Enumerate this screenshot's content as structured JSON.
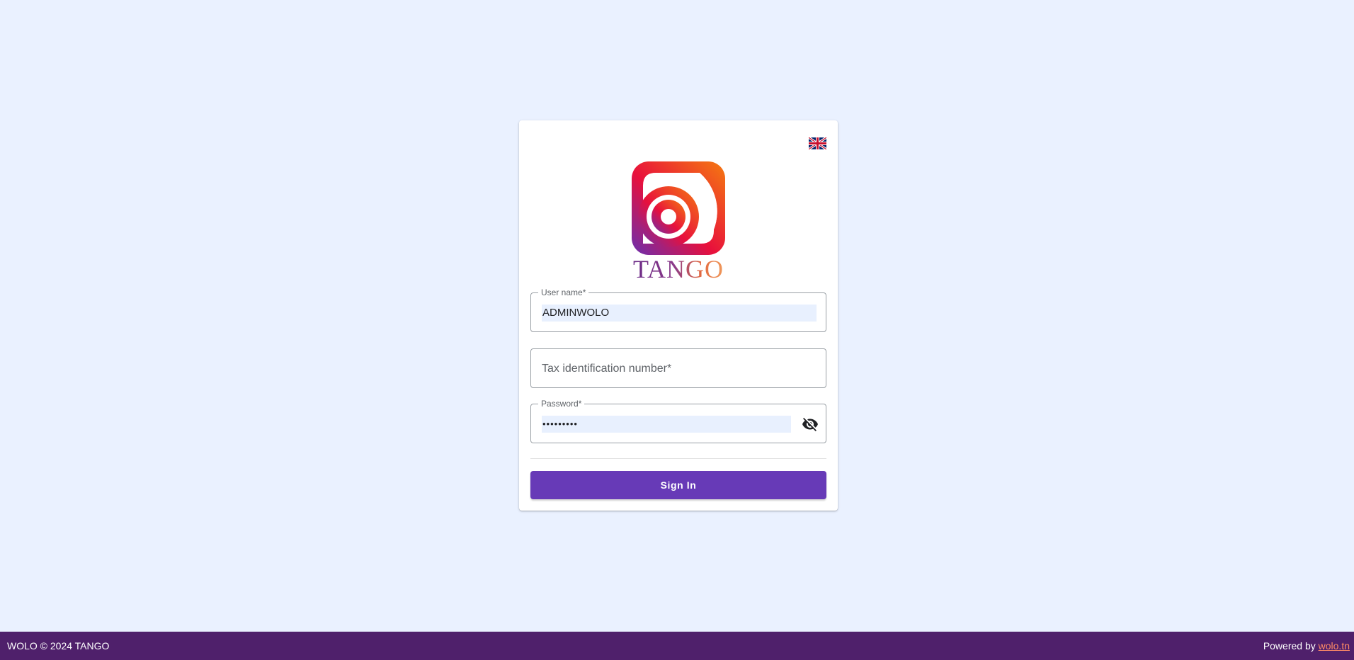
{
  "card": {
    "language_flag": "uk-flag-icon",
    "logo_icon": "tango-logo-icon",
    "logo_text": "TANGO"
  },
  "form": {
    "username": {
      "label": "User name*",
      "value": "ADMINWOLO"
    },
    "tax_id": {
      "placeholder": "Tax identification number*",
      "value": ""
    },
    "password": {
      "label": "Password*",
      "masked_value": "•••••••••",
      "toggle_icon": "eye-off-icon"
    },
    "sign_in_label": "Sign In"
  },
  "footer": {
    "left_text": "WOLO © 2024 TANGO",
    "powered_by": "Powered by",
    "link_text": "wolo.tn"
  },
  "colors": {
    "background": "#eaf1ff",
    "primary_button": "#673ab7",
    "footer": "#4f206b",
    "footer_link": "#ff8a65"
  }
}
